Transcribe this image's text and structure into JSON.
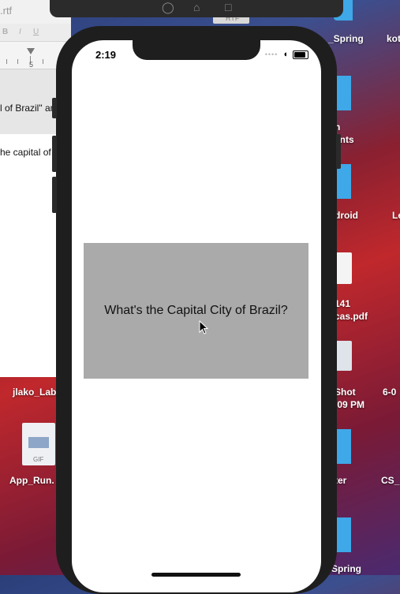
{
  "textedit": {
    "title": ".rtf",
    "format_bold": "B",
    "format_italic": "I",
    "format_underline": "U",
    "ruler_number": "5",
    "line1": "l of Brazil\" an",
    "line2": "he capital of"
  },
  "desktop": {
    "icons": [
      {
        "label": "_Spring"
      },
      {
        "label": "kot"
      },
      {
        "label": "n"
      },
      {
        "label": "ents"
      },
      {
        "label": "droid"
      },
      {
        "label": "Le"
      },
      {
        "label": "141"
      },
      {
        "label": "cas.pdf"
      },
      {
        "label": "Shot"
      },
      {
        "label": "6-0"
      },
      {
        "label": ".09 PM"
      },
      {
        "label": "jlako_Lab"
      },
      {
        "label": "App_Run."
      },
      {
        "label": "ter"
      },
      {
        "label": "CS_"
      },
      {
        "label": "Spring"
      }
    ],
    "gif_label": "GIF",
    "rtf_label": "RTF"
  },
  "simulator": {
    "status_time": "2:19",
    "question": "What's the Capital City of Brazil?"
  },
  "colors": {
    "card_background": "#aaaaaa",
    "screen_background": "#ffffff",
    "phone_frame": "#1e1e1e"
  }
}
